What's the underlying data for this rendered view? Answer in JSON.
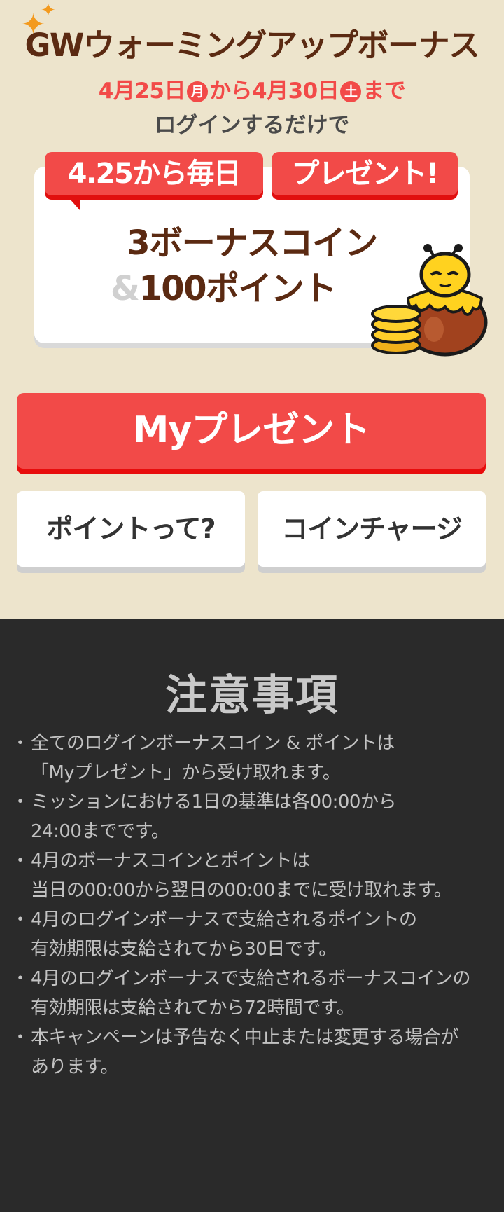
{
  "header": {
    "title": "GWウォーミングアップボーナス",
    "date_start": "4月25日",
    "day_start": "月",
    "date_mid": "から4月30日",
    "day_end": "土",
    "date_suffix": "まで",
    "subtitle": "ログインするだけで"
  },
  "card": {
    "ribbon_left": "4.25から毎日",
    "ribbon_right": "プレゼント!",
    "reward_line1": "3ボーナスコイン",
    "reward_amp": "&",
    "reward_line2": "100ポイント"
  },
  "buttons": {
    "my_present": "Myプレゼント",
    "points_info": "ポイントって?",
    "coin_charge": "コインチャージ"
  },
  "notes": {
    "title": "注意事項",
    "items": [
      "全てのログインボーナスコイン & ポイントは\n「Myプレゼント」から受け取れます。",
      "ミッションにおける1日の基準は各00:00から\n24:00までです。",
      "4月のボーナスコインとポイントは\n当日の00:00から翌日の00:00までに受け取れます。",
      "4月のログインボーナスで支給されるポイントの\n有効期限は支給されてから30日です。",
      "4月のログインボーナスで支給されるボーナスコインの\n有効期限は支給されてから72時間です。",
      "本キャンペーンは予告なく中止または変更する場合が\nあります。"
    ]
  },
  "colors": {
    "top_background": "#ede4cc",
    "bottom_background": "#2a2a2a",
    "accent_red": "#f24a48",
    "title_brown": "#5b2a12",
    "highlight_yellow": "#fbe85a",
    "sparkle_orange": "#f39a1e"
  },
  "icons": {
    "sparkle": "sparkle-icon",
    "mascot": "bee-mascot-illustration"
  }
}
